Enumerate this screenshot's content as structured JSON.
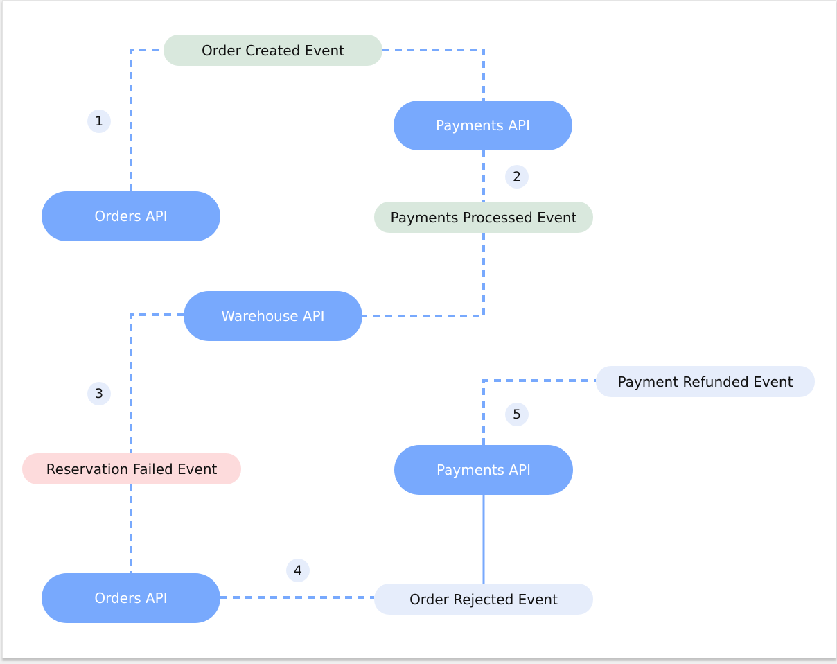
{
  "colors": {
    "api": "#78a9fd",
    "line": "#78a9fd",
    "event_success": "#d9e8dd",
    "event_failure": "#fddbdc",
    "event_neutral": "#e6edfb"
  },
  "nodes": {
    "orders_api_1": "Orders API",
    "order_created_event": "Order Created Event",
    "payments_api_1": "Payments API",
    "payments_processed_event": "Payments Processed Event",
    "warehouse_api": "Warehouse API",
    "reservation_failed_event": "Reservation Failed Event",
    "orders_api_2": "Orders API",
    "order_rejected_event": "Order Rejected Event",
    "payments_api_2": "Payments API",
    "payment_refunded_event": "Payment Refunded Event"
  },
  "steps": [
    "1",
    "2",
    "3",
    "4",
    "5"
  ]
}
